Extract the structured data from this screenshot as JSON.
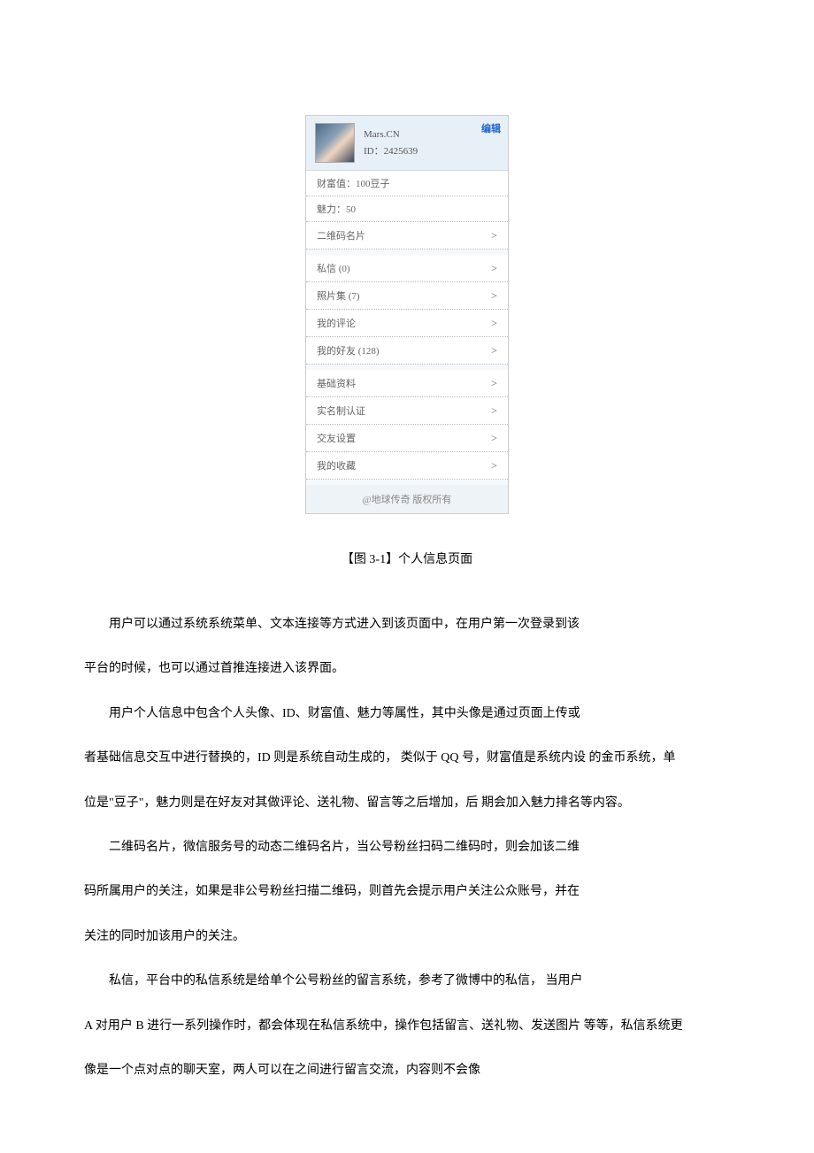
{
  "mockup": {
    "name": "Mars.CN",
    "id_label": "ID：2425639",
    "edit": "编辑",
    "wealth": "财富值：100豆子",
    "charm": "魅力：50",
    "qrcard": "二维码名片",
    "msg": "私信 (0)",
    "photos": "照片集 (7)",
    "comments": "我的评论",
    "friends": "我的好友 (128)",
    "profile": "基础资料",
    "realname": "实名制认证",
    "social": "交友设置",
    "favorites": "我的收藏",
    "footer": "@地球传奇 版权所有"
  },
  "caption": "【图 3-1】个人信息页面",
  "paragraphs": {
    "p1a": "用户可以通过系统系统菜单、文本连接等方式进入到该页面中，在用户第一次登录到该",
    "p1b": "平台的时候，也可以通过首推连接进入该界面。",
    "p2a": "用户个人信息中包含个人头像、ID、财富值、魅力等属性，其中头像是通过页面上传或",
    "p2b": "者基础信息交互中进行替换的，ID 则是系统自动生成的， 类似于 QQ 号，财富值是系统内设 的金币系统，单",
    "p2c": "位是\"豆子\"，魅力则是在好友对其做评论、送礼物、留言等之后增加，后 期会加入魅力排名等内容。",
    "p3a": "二维码名片，微信服务号的动态二维码名片，当公号粉丝扫码二维码时，则会加该二维",
    "p3b": "码所属用户的关注，如果是非公号粉丝扫描二维码，则首先会提示用户关注公众账号，并在",
    "p3c": "关注的同时加该用户的关注。",
    "p4a": "私信，平台中的私信系统是给单个公号粉丝的留言系统，参考了微博中的私信， 当用户",
    "p4b": "A 对用户 B 进行一系列操作时，都会体现在私信系统中，操作包括留言、送礼物、发送图片 等等，私信系统更",
    "p4c": "像是一个点对点的聊天室，两人可以在之间进行留言交流，内容则不会像"
  }
}
